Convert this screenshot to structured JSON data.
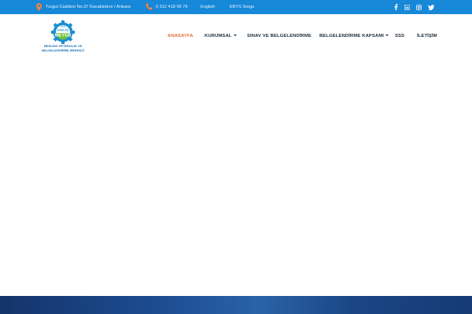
{
  "topbar": {
    "address": "Turgut Caddesi No.37 Kavaklıdere / Ankara",
    "phone": "0 312 418 00 79",
    "english": "English",
    "ebys": "EBYS Sorgu",
    "icons": [
      "location-pin-icon",
      "phone-icon",
      "facebook-icon",
      "linkedin-icon",
      "instagram-icon",
      "twitter-icon"
    ]
  },
  "logo": {
    "year": "2012",
    "brand_top": "HAK-İŞ",
    "brand": "MEYEB",
    "line1": "MESLEKİ YETERLİLİK VE",
    "line2": "BELGELENDİRME MERKEZİ"
  },
  "nav": {
    "items": [
      {
        "label": "ANASAYFA",
        "active": true
      },
      {
        "label": "KURUMSAL",
        "dropdown": true
      },
      {
        "label": "SINAV VE BELGELENDİRME"
      },
      {
        "label": "BELGELENDİRME KAPSAMI",
        "dropdown": true
      },
      {
        "label": "SSS"
      },
      {
        "label": "İLETİŞİM"
      }
    ]
  },
  "colors": {
    "topbar": "#1787d8",
    "accent": "#e0703a",
    "nav_text": "#1b2b3a",
    "logo_blue": "#1c8fd1",
    "logo_green": "#6bbf3a"
  }
}
